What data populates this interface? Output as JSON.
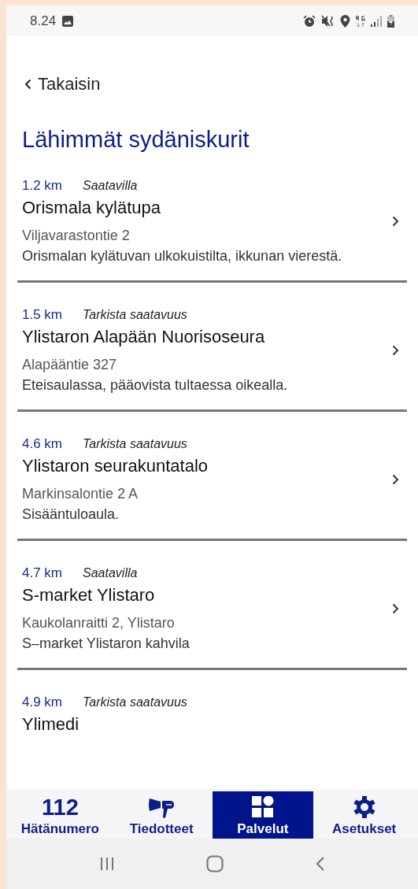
{
  "status_bar": {
    "time": "8.24"
  },
  "back_link": {
    "label": "Takaisin"
  },
  "title": "Lähimmät sydäniskurit",
  "items": [
    {
      "distance": "1.2 km",
      "availability": "Saatavilla",
      "name": "Orismala kylätupa",
      "address": "Viljavarastontie 2",
      "description": "Orismalan kylätuvan ulkokuistilta, ikkunan vierestä."
    },
    {
      "distance": "1.5 km",
      "availability": "Tarkista saatavuus",
      "name": "Ylistaron Alapään Nuorisoseura",
      "address": "Alapääntie 327",
      "description": "Eteisaulassa, pääovista tultaessa oikealla."
    },
    {
      "distance": "4.6 km",
      "availability": "Tarkista saatavuus",
      "name": "Ylistaron seurakuntatalo",
      "address": "Markinsalontie 2 A",
      "description": "Sisääntuloaula."
    },
    {
      "distance": "4.7 km",
      "availability": "Saatavilla",
      "name": "S-market Ylistaro",
      "address": "Kaukolanraitti 2, Ylistaro",
      "description": "S–market Ylistaron kahvila"
    },
    {
      "distance": "4.9 km",
      "availability": "Tarkista saatavuus",
      "name": "Ylimedi"
    }
  ],
  "nav": [
    {
      "kind": "number",
      "icon_text": "112",
      "label": "Hätänumero",
      "selected": false
    },
    {
      "kind": "megaphone",
      "label": "Tiedotteet",
      "selected": false
    },
    {
      "kind": "grid",
      "label": "Palvelut",
      "selected": true
    },
    {
      "kind": "gear",
      "label": "Asetukset",
      "selected": false
    }
  ]
}
